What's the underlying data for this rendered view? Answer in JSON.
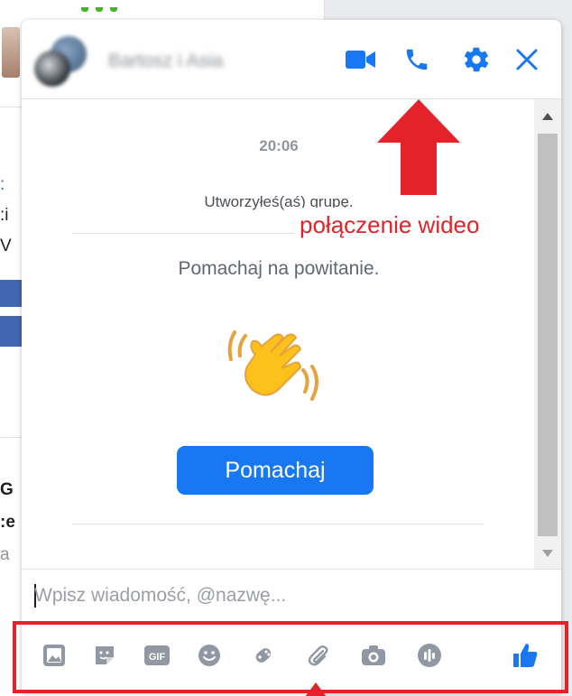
{
  "chat": {
    "name": "Bartosz i Asia",
    "timestamp": "20:06",
    "system_message": "Utworzyłeś(aś) grupę.",
    "wave_prompt": "Pomachaj na powitanie.",
    "wave_button_label": "Pomachaj",
    "composer_placeholder": "Wpisz wiadomość, @nazwę..."
  },
  "header_icons": [
    "video-camera-icon",
    "phone-icon",
    "gear-icon",
    "close-icon"
  ],
  "toolbar_icons": [
    "photo-icon",
    "sticker-icon",
    "gif-icon",
    "emoji-icon",
    "game-icon",
    "attachment-icon",
    "camera-icon",
    "audio-icon",
    "like-icon"
  ],
  "annotation": {
    "label": "połączenie wideo"
  },
  "colors": {
    "accent": "#1877f2",
    "annotation_red": "#e3222a",
    "toolbar_icon_gray": "#9197a3"
  }
}
